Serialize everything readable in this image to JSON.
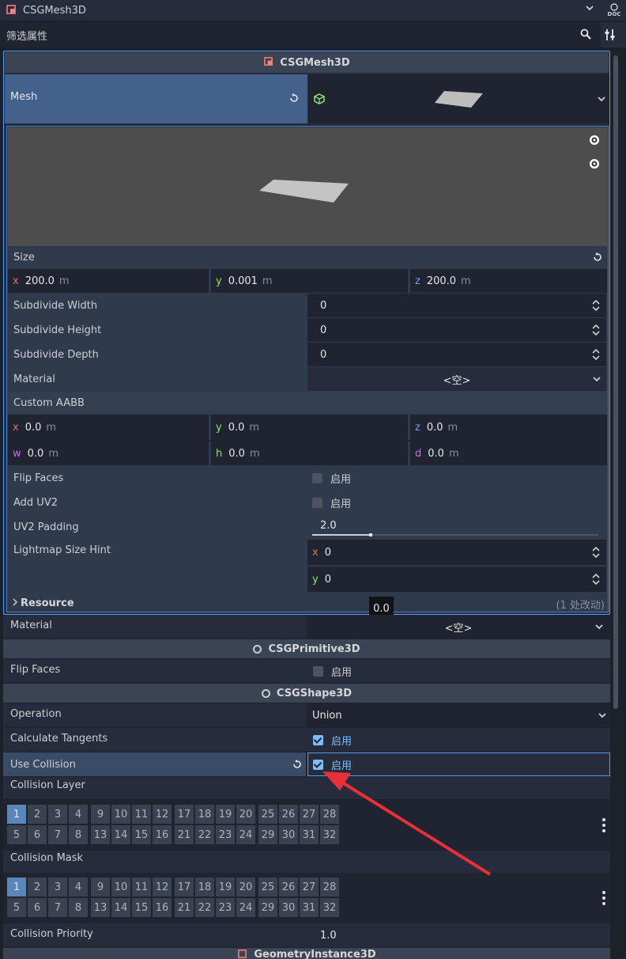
{
  "header": {
    "node_name": "CSGMesh3D",
    "doc_label": "DOC",
    "filter_placeholder": "筛选属性"
  },
  "mesh_section": {
    "title": "CSGMesh3D",
    "mesh_label": "Mesh",
    "size_label": "Size",
    "size": {
      "x": "200.0",
      "y": "0.001",
      "z": "200.0",
      "unit": "m"
    },
    "subdivide_width_label": "Subdivide Width",
    "subdivide_width": "0",
    "subdivide_height_label": "Subdivide Height",
    "subdivide_height": "0",
    "subdivide_depth_label": "Subdivide Depth",
    "subdivide_depth": "0",
    "material_label": "Material",
    "material_value": "<空>",
    "custom_aabb_label": "Custom AABB",
    "aabb": {
      "x": "0.0",
      "y": "0.0",
      "z": "0.0",
      "w": "0.0",
      "h": "0.0",
      "d": "0.0",
      "unit": "m"
    },
    "flip_faces_label": "Flip Faces",
    "flip_faces_text": "启用",
    "add_uv2_label": "Add UV2",
    "add_uv2_text": "启用",
    "uv2_padding_label": "UV2 Padding",
    "uv2_padding": "2.0",
    "uv2_padding_fraction": 0.1,
    "lightmap_label": "Lightmap Size Hint",
    "lightmap_x": "0",
    "lightmap_y": "0",
    "resource_label": "Resource",
    "resource_changes": "(1 处改动)",
    "tooltip": "0.0"
  },
  "outer_material": {
    "label": "Material",
    "value": "<空>"
  },
  "csg_primitive": {
    "title": "CSGPrimitive3D",
    "flip_faces_label": "Flip Faces",
    "flip_faces_text": "启用"
  },
  "csg_shape": {
    "title": "CSGShape3D",
    "operation_label": "Operation",
    "operation_value": "Union",
    "calc_tangents_label": "Calculate Tangents",
    "calc_tangents_text": "启用",
    "use_collision_label": "Use Collision",
    "use_collision_text": "启用",
    "collision_layer_label": "Collision Layer",
    "collision_mask_label": "Collision Mask",
    "layer_groups": [
      [
        "1",
        "2",
        "3",
        "4",
        "5",
        "6",
        "7",
        "8"
      ],
      [
        "9",
        "10",
        "11",
        "12",
        "13",
        "14",
        "15",
        "16"
      ],
      [
        "17",
        "18",
        "19",
        "20",
        "21",
        "22",
        "23",
        "24"
      ],
      [
        "25",
        "26",
        "27",
        "28",
        "29",
        "30",
        "31",
        "32"
      ]
    ],
    "collision_priority_label": "Collision Priority",
    "collision_priority": "1.0"
  },
  "geometry_instance": {
    "title": "GeometryInstance3D"
  },
  "axis_labels": {
    "x": "x",
    "y": "y",
    "z": "z",
    "w": "w",
    "h": "h",
    "d": "d"
  },
  "colors": {
    "accent": "#569eff",
    "checkbox_on": "#7dbdff",
    "arrow": "#e8303a",
    "axis_x": "#e0726c",
    "axis_y": "#8ee56e",
    "axis_z": "#7f98f5",
    "selected_layer": "#5b86b8"
  }
}
